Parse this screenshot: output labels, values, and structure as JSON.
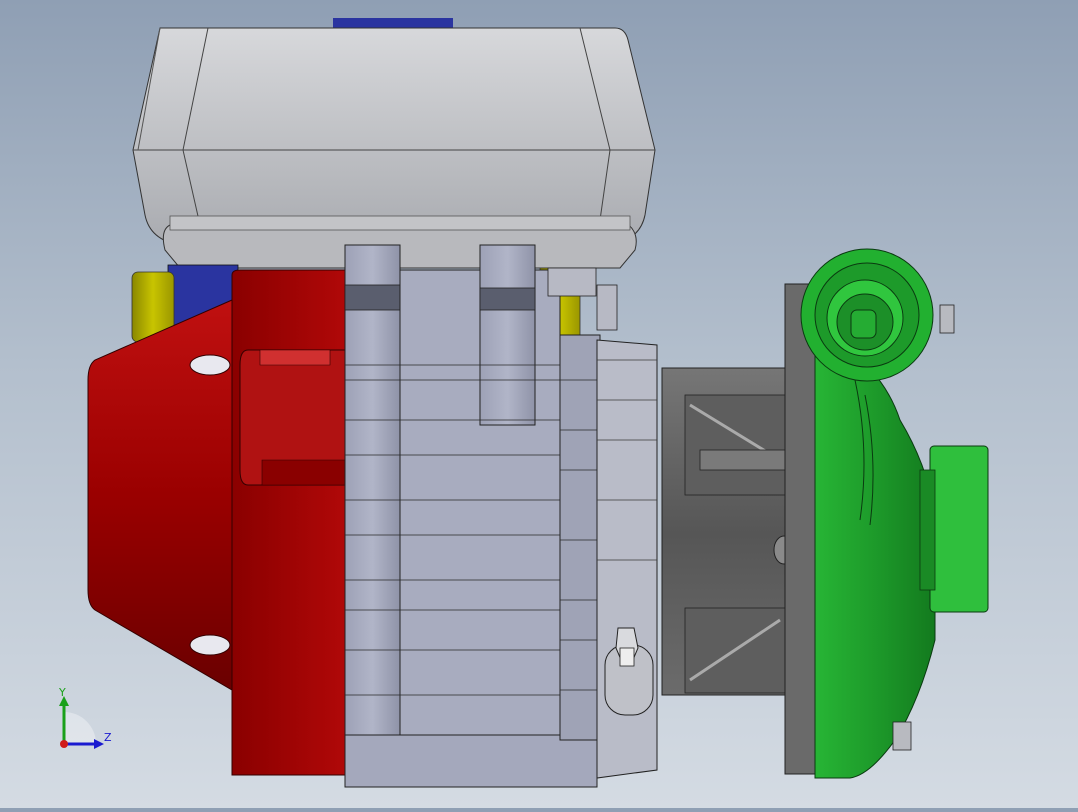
{
  "viewport": {
    "background_top": "#8f9fb4",
    "background_bottom": "#d4dbe3"
  },
  "model": {
    "parts": [
      {
        "name": "air-filter-housing",
        "color": "#c8c9cc"
      },
      {
        "name": "engine-cover",
        "color": "#a4a8bc"
      },
      {
        "name": "recoil-starter-cover",
        "color": "#990000"
      },
      {
        "name": "fuel-tank-cap",
        "color": "#2a34a0"
      },
      {
        "name": "side-tank",
        "color": "#b8b400"
      },
      {
        "name": "pump-bracket",
        "color": "#5c5c5c"
      },
      {
        "name": "pump-volute",
        "color": "#1f9e2c"
      }
    ]
  },
  "triad": {
    "y_label": "Y",
    "z_label": "Z",
    "y_color": "#1aa01a",
    "z_color": "#1a1ad0",
    "x_color": "#d01a1a"
  }
}
